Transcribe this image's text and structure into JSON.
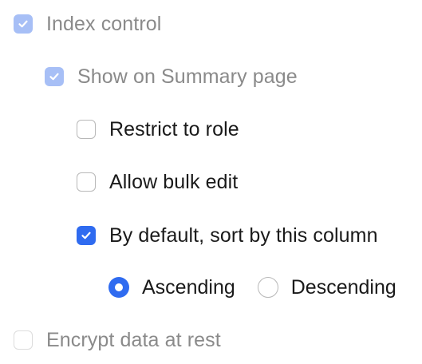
{
  "options": {
    "index_control": {
      "label": "Index control",
      "checked": true,
      "disabled": true
    },
    "show_on_summary": {
      "label": "Show on Summary page",
      "checked": true,
      "disabled": true
    },
    "restrict_to_role": {
      "label": "Restrict to role",
      "checked": false,
      "disabled": false
    },
    "allow_bulk_edit": {
      "label": "Allow bulk edit",
      "checked": false,
      "disabled": false
    },
    "default_sort": {
      "label": "By default, sort by this column",
      "checked": true,
      "disabled": false
    },
    "encrypt_at_rest": {
      "label": "Encrypt data at rest",
      "checked": false,
      "disabled": true
    }
  },
  "sort_direction": {
    "selected": "Ascending",
    "options": [
      {
        "label": "Ascending"
      },
      {
        "label": "Descending"
      }
    ]
  },
  "colors": {
    "accent": "#2f6bf0",
    "accent_disabled": "#a7bff6",
    "text": "#1a1a1a",
    "text_disabled": "#8a8a8a",
    "border": "#b8b8b8",
    "border_disabled": "#dcdcdc"
  },
  "icons": {
    "checked": "checkmark-icon"
  }
}
